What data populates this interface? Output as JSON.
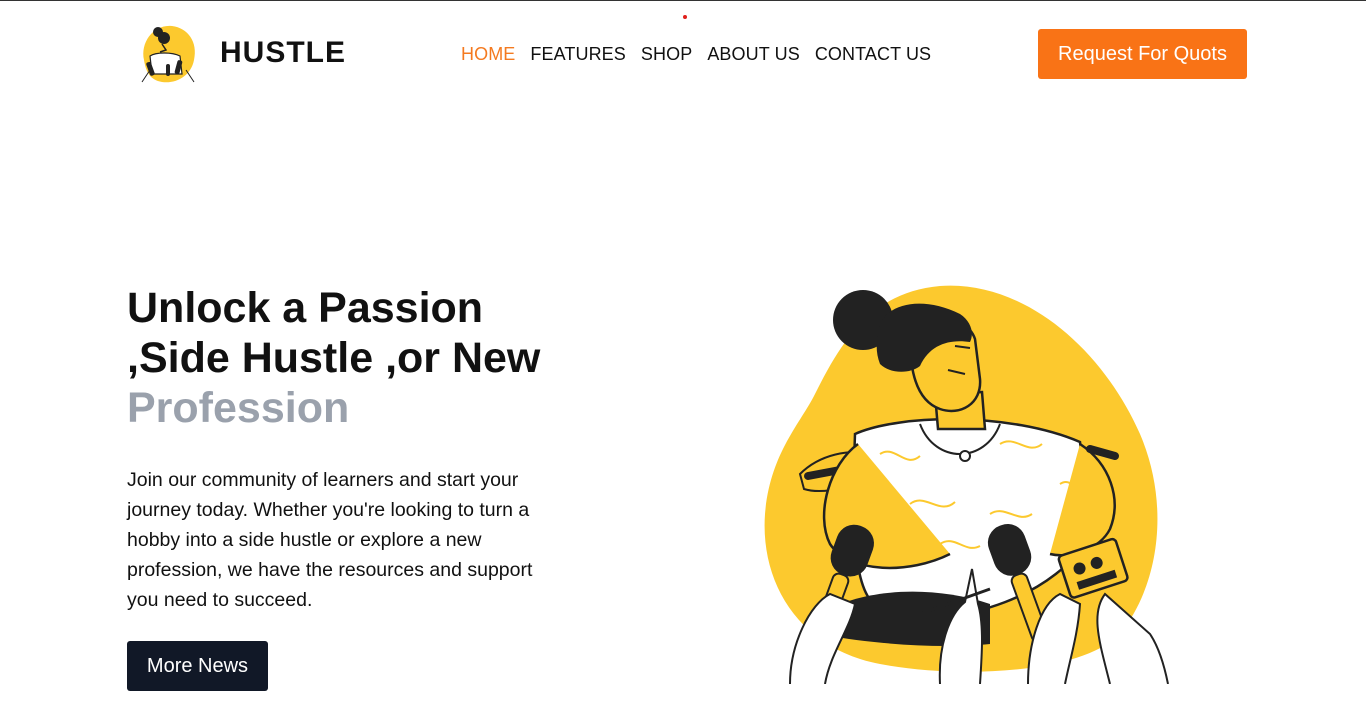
{
  "brand": {
    "name": "HUSTLE",
    "logo_icon": "woman-reporter-logo-icon"
  },
  "nav": {
    "items": [
      {
        "label": "HOME",
        "active": true
      },
      {
        "label": "FEATURES",
        "active": false
      },
      {
        "label": "SHOP",
        "active": false
      },
      {
        "label": "ABOUT US",
        "active": false
      },
      {
        "label": "CONTACT US",
        "active": false
      }
    ]
  },
  "header": {
    "cta_label": "Request For Quots"
  },
  "hero": {
    "title_line1": "Unlock a Passion",
    "title_line2": ",Side Hustle ,or New",
    "title_line3": "Profession",
    "body": "Join our community of learners and start your journey today. Whether you're looking to turn a hobby into a side hustle or explore a new profession, we have the resources and support you need to succeed.",
    "button_label": "More News",
    "illustration_icon": "woman-interview-microphones-illustration"
  },
  "colors": {
    "accent": "#f97316",
    "nav_active": "#f47a20",
    "dark_button": "#111827",
    "muted_text": "#9aa1ac",
    "illustration_yellow": "#fcc92e"
  }
}
